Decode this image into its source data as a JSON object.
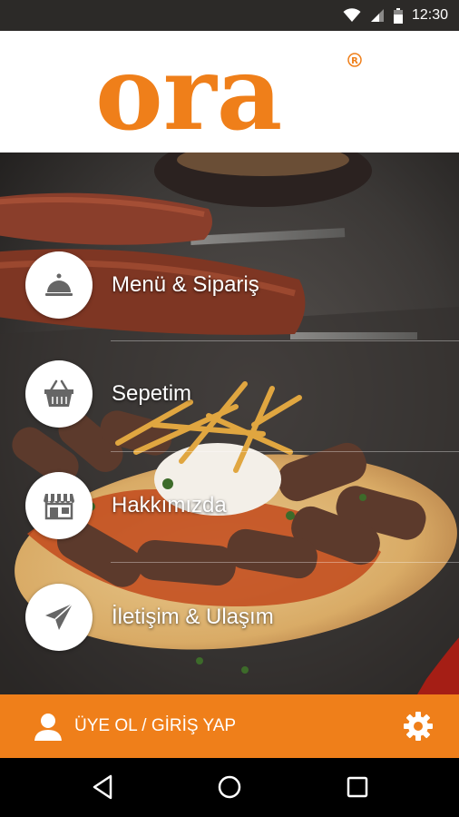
{
  "status_bar": {
    "time": "12:30"
  },
  "header": {
    "logo_text": "ora",
    "logo_mark": "®"
  },
  "menu": [
    {
      "label": "Menü & Sipariş",
      "icon": "cloche-icon"
    },
    {
      "label": "Sepetim",
      "icon": "basket-icon"
    },
    {
      "label": "Hakkımızda",
      "icon": "storefront-icon"
    },
    {
      "label": "İletişim & Ulaşım",
      "icon": "paper-plane-icon"
    }
  ],
  "bottom_bar": {
    "login_label": "ÜYE OL / GİRİŞ YAP",
    "user_icon": "user-icon",
    "settings_icon": "gear-icon"
  },
  "colors": {
    "accent": "#ef7f1a",
    "status_bar": "#2c2a28",
    "nav_bar": "#000000",
    "icon_gray": "#666666"
  }
}
